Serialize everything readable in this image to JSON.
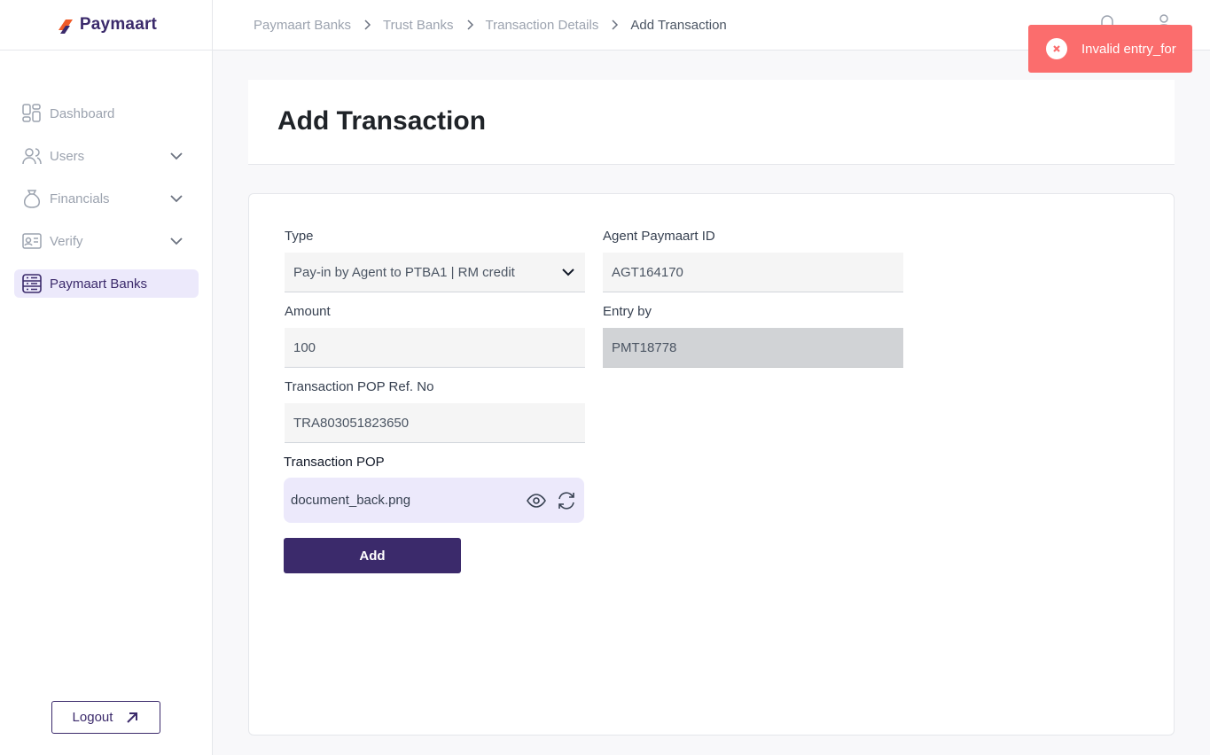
{
  "brand": {
    "name": "Paymaart",
    "colors": {
      "primary": "#3b2a6b",
      "accent": "#f05a28",
      "toast_error": "#fb6d6d",
      "active_nav_bg": "#ece9fb"
    }
  },
  "sidebar": {
    "items": [
      {
        "label": "Dashboard",
        "icon": "dashboard-icon",
        "expandable": false,
        "active": false
      },
      {
        "label": "Users",
        "icon": "users-icon",
        "expandable": true,
        "active": false
      },
      {
        "label": "Financials",
        "icon": "money-bag-icon",
        "expandable": true,
        "active": false
      },
      {
        "label": "Verify",
        "icon": "id-card-icon",
        "expandable": true,
        "active": false
      },
      {
        "label": "Paymaart Banks",
        "icon": "bank-list-icon",
        "expandable": false,
        "active": true
      }
    ],
    "logout_label": "Logout"
  },
  "breadcrumb": [
    "Paymaart Banks",
    "Trust Banks",
    "Transaction Details",
    "Add Transaction"
  ],
  "toast": {
    "message": "Invalid entry_for",
    "type": "error"
  },
  "page": {
    "title": "Add Transaction"
  },
  "form": {
    "type": {
      "label": "Type",
      "value": "Pay-in by Agent to PTBA1 | RM credit"
    },
    "agent_id": {
      "label": "Agent Paymaart ID",
      "value": "AGT164170"
    },
    "amount": {
      "label": "Amount",
      "value": "100"
    },
    "entry_by": {
      "label": "Entry by",
      "value": "PMT18778"
    },
    "pop_ref": {
      "label": "Transaction POP Ref. No",
      "value": "TRA803051823650"
    },
    "pop_file": {
      "label": "Transaction POP",
      "file_name": "document_back.png"
    },
    "submit_label": "Add"
  }
}
